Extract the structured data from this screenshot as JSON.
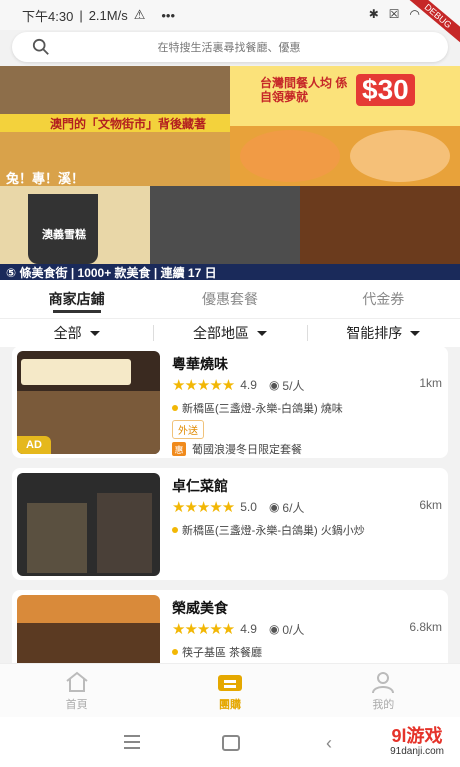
{
  "status_bar": {
    "time": "下午4:30",
    "speed": "2.1M/s",
    "debug_label": "DEBUG"
  },
  "search": {
    "placeholder": "在特搜生活裏尋找餐廳、優惠"
  },
  "banner": {
    "texts": [
      "澳門的「文物街市」背後藏著",
      "兔！專！溪！",
      "台灣間餐人均 係自領夢就",
      "$30",
      "⑤ 條美食街 | 1000+ 款美食 | 連續 17 日",
      "澳義雪糕"
    ]
  },
  "tabs": [
    {
      "label": "商家店鋪",
      "active": true
    },
    {
      "label": "優惠套餐",
      "active": false
    },
    {
      "label": "代金券",
      "active": false
    }
  ],
  "filters": [
    {
      "label": "全部"
    },
    {
      "label": "全部地區"
    },
    {
      "label": "智能排序"
    }
  ],
  "restaurants": [
    {
      "name": "粵華燒味",
      "score": "4.9",
      "people": "5/人",
      "distance": "1km",
      "location": "新橋區(三盞燈-永樂-白鴿巢) 燒味",
      "tag": "外送",
      "promo": "葡國浪漫冬日限定套餐",
      "ad": "AD",
      "promo_icon": "惠",
      "stars": "★★★★★"
    },
    {
      "name": "卓仁菜館",
      "score": "5.0",
      "people": "6/人",
      "distance": "6km",
      "location": "新橋區(三盞燈-永樂-白鴿巢) 火鍋小炒",
      "stars": "★★★★★"
    },
    {
      "name": "榮威美食",
      "score": "4.9",
      "people": "0/人",
      "distance": "6.8km",
      "location": "筷子基區 茶餐廳",
      "stars": "★★★★★"
    }
  ],
  "bottom_nav": [
    {
      "label": "首頁",
      "active": false
    },
    {
      "label": "團購",
      "active": true
    },
    {
      "label": "我的",
      "active": false
    }
  ],
  "watermark": {
    "logo": "9l游戏",
    "url": "91danji.com"
  },
  "colors": {
    "accent": "#e5a800",
    "star": "#f2b705",
    "ad": "#e5b81d",
    "brand_red": "#e5332a"
  }
}
